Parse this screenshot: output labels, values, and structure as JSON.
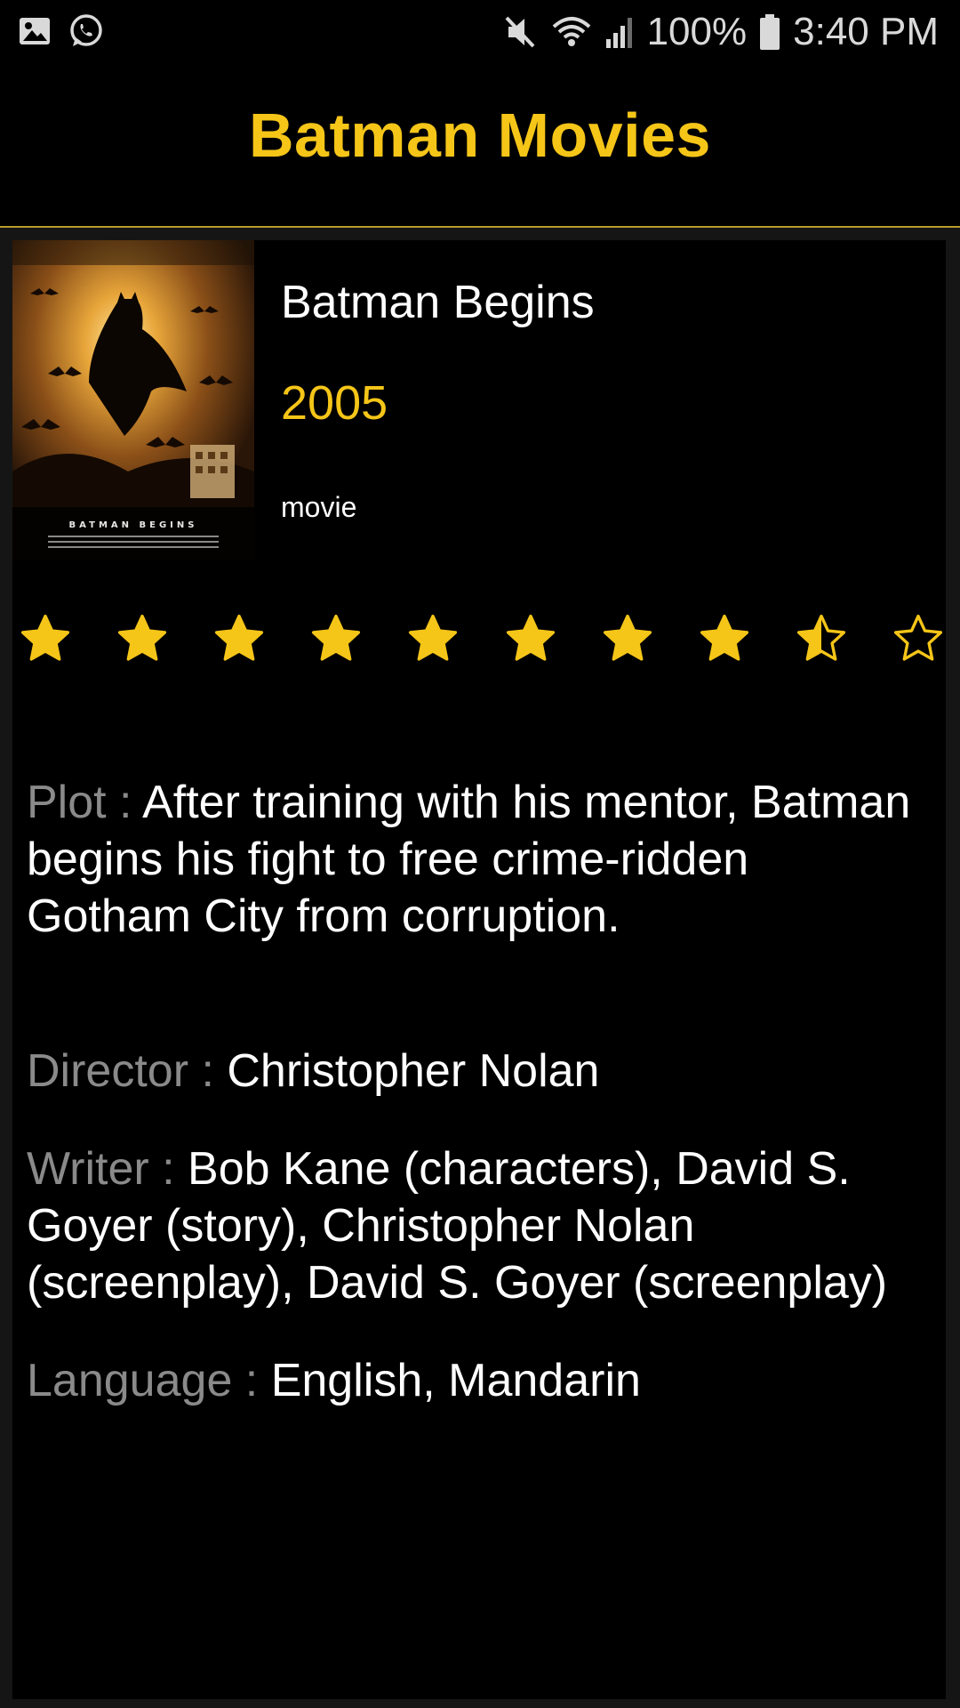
{
  "status_bar": {
    "battery": "100%",
    "time": "3:40 PM",
    "icons": [
      "gallery-icon",
      "whatsapp-icon",
      "mute-icon",
      "wifi-icon",
      "signal-icon",
      "battery-icon"
    ]
  },
  "app_bar": {
    "title": "Batman Movies"
  },
  "movie": {
    "title": "Batman Begins",
    "year": "2005",
    "type": "movie",
    "poster_text": "BATMAN BEGINS",
    "rating": {
      "value": 8.5,
      "max": 10
    },
    "plot_label": "Plot : ",
    "plot": "After training with his mentor, Batman begins his fight to free crime-ridden Gotham City from corruption.",
    "director_label": "Director : ",
    "director": "Christopher Nolan",
    "writer_label": "Writer : ",
    "writer": "Bob Kane (characters), David S. Goyer (story), Christopher Nolan (screenplay), David S. Goyer (screenplay)",
    "language_label": "Language : ",
    "language": "English, Mandarin"
  },
  "colors": {
    "accent": "#f5c518",
    "label_gray": "#8a8a8a",
    "background": "#000000"
  }
}
